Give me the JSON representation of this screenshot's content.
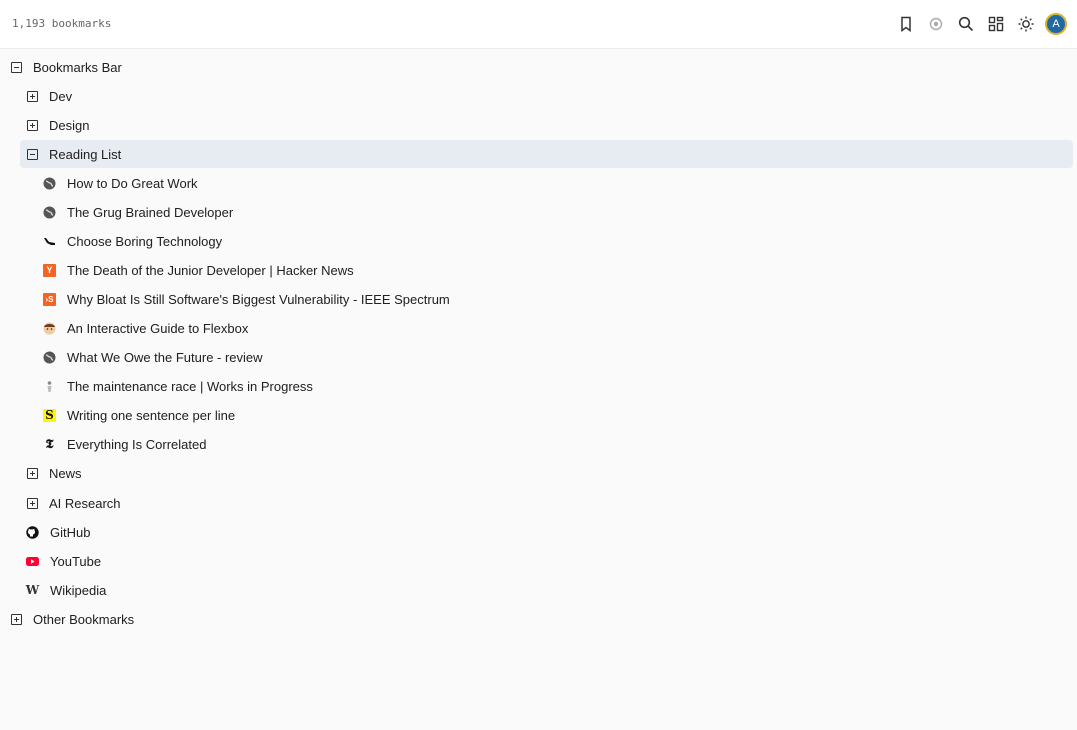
{
  "header": {
    "count": "1,193 bookmarks",
    "avatar_initial": "A",
    "tools": [
      "bookmark-icon",
      "target-icon",
      "search-icon",
      "grid-icon",
      "sun-icon"
    ]
  },
  "tree": {
    "bookmarks_bar": "Bookmarks Bar",
    "dev": "Dev",
    "design": "Design",
    "reading_list": "Reading List",
    "reading_items": [
      "How to Do Great Work",
      "The Grug Brained Developer",
      "Choose Boring Technology",
      "The Death of the Junior Developer | Hacker News",
      "Why Bloat Is Still Software's Biggest Vulnerability - IEEE Spectrum",
      "An Interactive Guide to Flexbox",
      "What We Owe the Future - review",
      "The maintenance race | Works in Progress",
      "Writing one sentence per line",
      "Everything Is Correlated"
    ],
    "favicon_glyphs": {
      "hn": "Y",
      "ieee": "›S",
      "substack": "S",
      "nyt": "𝕿",
      "wikipedia": "W"
    },
    "news": "News",
    "ai_research": "AI Research",
    "github": "GitHub",
    "youtube": "YouTube",
    "wikipedia": "Wikipedia",
    "other_bookmarks": "Other Bookmarks"
  },
  "colors": {
    "selected_row": "#e7ecf2",
    "avatar_bg": "#1f6aa5",
    "avatar_ring": "#d8b32e",
    "hn_orange": "#f26522",
    "youtube_red": "#ff0033"
  }
}
